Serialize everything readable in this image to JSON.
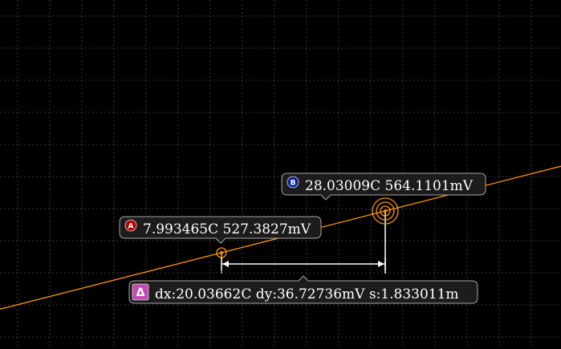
{
  "chart_data": {
    "type": "line",
    "grid": true,
    "series": [
      {
        "color": "#ff9500",
        "points": [
          {
            "x": 7.993465,
            "y": 527.3827
          },
          {
            "x": 28.03009,
            "y": 564.1101
          }
        ]
      }
    ],
    "cursors": [
      {
        "id": "A",
        "badge_color": "#b40000",
        "label": "7.993465C 527.3827mV",
        "x": 7.993465,
        "y": 527.3827
      },
      {
        "id": "B",
        "badge_color": "#0a1ea0",
        "label": "28.03009C 564.1101mV",
        "x": 28.03009,
        "y": 564.1101
      }
    ],
    "delta": {
      "symbol": "Δ",
      "badge_color": "#c34bb4",
      "label": "dx:20.03662C dy:36.72736mV s:1.833011m"
    }
  }
}
